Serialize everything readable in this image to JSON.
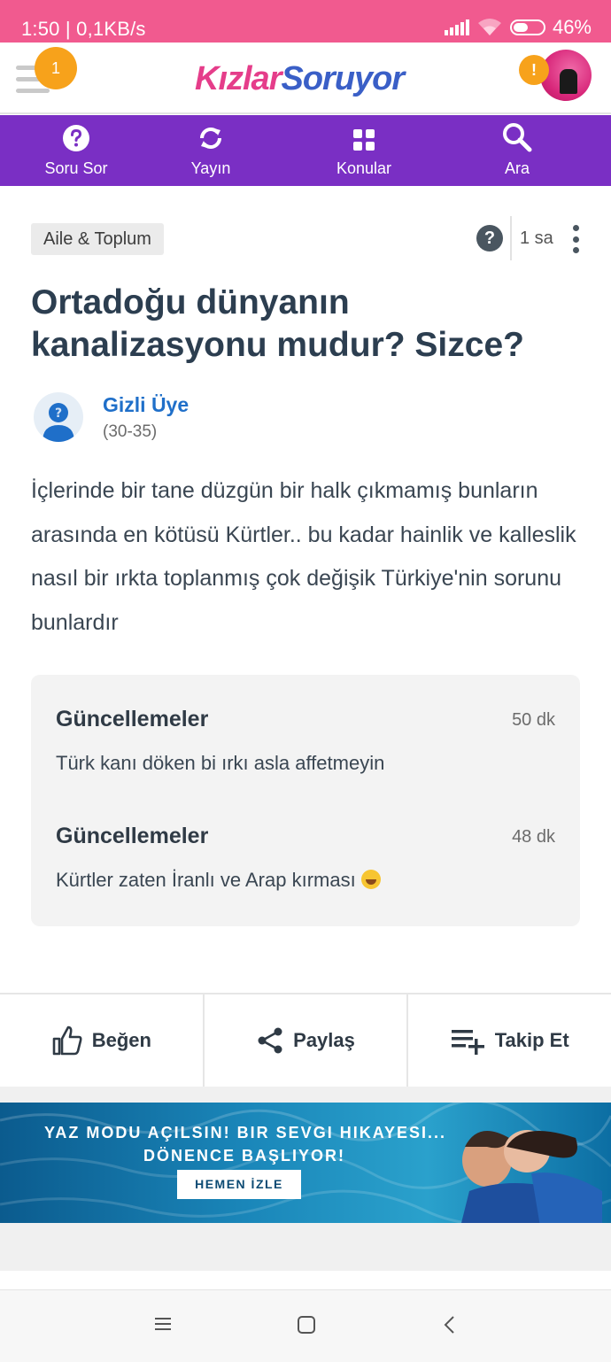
{
  "status_bar": {
    "time_speed": "1:50 | 0,1KB/s",
    "battery": "46%"
  },
  "header": {
    "notification_count": "1",
    "logo_part1": "Kızlar",
    "logo_part2": "Soruyor",
    "alert_mark": "!"
  },
  "nav": {
    "items": [
      {
        "label": "Soru Sor",
        "icon": "question-circle-icon"
      },
      {
        "label": "Yayın",
        "icon": "refresh-icon"
      },
      {
        "label": "Konular",
        "icon": "grid-icon"
      },
      {
        "label": "Ara",
        "icon": "search-icon"
      }
    ]
  },
  "question": {
    "category": "Aile & Toplum",
    "help_mark": "?",
    "time_ago": "1 sa",
    "title": "Ortadoğu dünyanın kanalizasyonu mudur? Sizce?",
    "author_name": "Gizli Üye",
    "author_age": "(30-35)",
    "body": "İçlerinde bir tane düzgün bir halk çıkmamış bunların arasında en kötüsü Kürtler.. bu kadar hainlik ve kalleslik nasıl bir ırkta toplanmış çok değişik Türkiye'nin sorunu bunlardır"
  },
  "updates": [
    {
      "title": "Güncellemeler",
      "time": "50 dk",
      "text": "Türk kanı döken bi ırkı asla affetmeyin"
    },
    {
      "title": "Güncellemeler",
      "time": "48 dk",
      "text": "Kürtler zaten İranlı ve Arap kırması"
    }
  ],
  "actions": {
    "like": "Beğen",
    "share": "Paylaş",
    "follow": "Takip Et"
  },
  "banner": {
    "line1": "YAZ MODU AÇILSIN! BIR SEVGI HIKAYESI...",
    "line2": "DÖNENCE BAŞLIYOR!",
    "button": "HEMEN İZLE"
  },
  "colors": {
    "status_bar": "#f15a8f",
    "nav": "#7a2fc4",
    "badge": "#f7a21b",
    "author": "#1f6fc9"
  }
}
